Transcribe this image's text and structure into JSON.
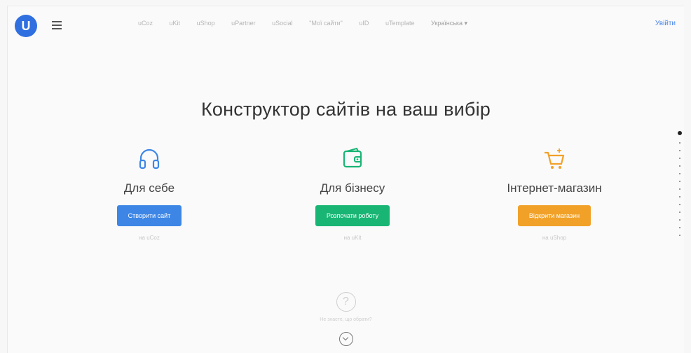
{
  "header": {
    "logo_letter": "U",
    "nav": [
      "uCoz",
      "uKit",
      "uShop",
      "uPartner",
      "uSocial",
      "\"Мої сайти\"",
      "uID",
      "uTemplate"
    ],
    "language": "Українська ▾",
    "login": "Увійти"
  },
  "hero": {
    "title": "Конструктор сайтів на ваш вибір"
  },
  "cards": [
    {
      "title": "Для себе",
      "button": "Створити сайт",
      "note": "на uCoz",
      "icon": "headphones-icon",
      "color": "#3d86e6"
    },
    {
      "title": "Для бізнесу",
      "button": "Розпочати роботу",
      "note": "на uKit",
      "icon": "wallet-icon",
      "color": "#18b574"
    },
    {
      "title": "Інтернет-магазин",
      "button": "Відкрити магазин",
      "note": "на uShop",
      "icon": "shopping-cart-icon",
      "color": "#f1a128"
    }
  ],
  "help": {
    "icon": "question-circle-icon",
    "text": "Не знаєте, що обрати?",
    "scroll_icon": "chevron-down-circle-icon"
  }
}
